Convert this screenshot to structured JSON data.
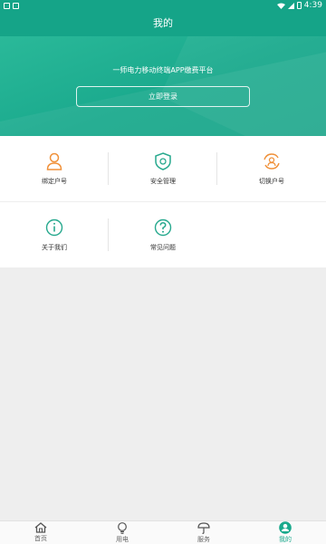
{
  "status_bar": {
    "time": "4:39"
  },
  "header": {
    "title": "我的"
  },
  "hero": {
    "subtitle": "一师电力移动终端APP缴费平台",
    "login_label": "立即登录"
  },
  "menu": {
    "bind_account": "绑定户号",
    "security": "安全管理",
    "switch_account": "切换户号",
    "about": "关于我们",
    "faq": "常见问题"
  },
  "tabbar": {
    "home": "首页",
    "electricity": "用电",
    "service": "服务",
    "mine": "我的"
  },
  "colors": {
    "accent": "#15a488",
    "orange": "#f0913a",
    "teal_icon": "#27a98e"
  }
}
